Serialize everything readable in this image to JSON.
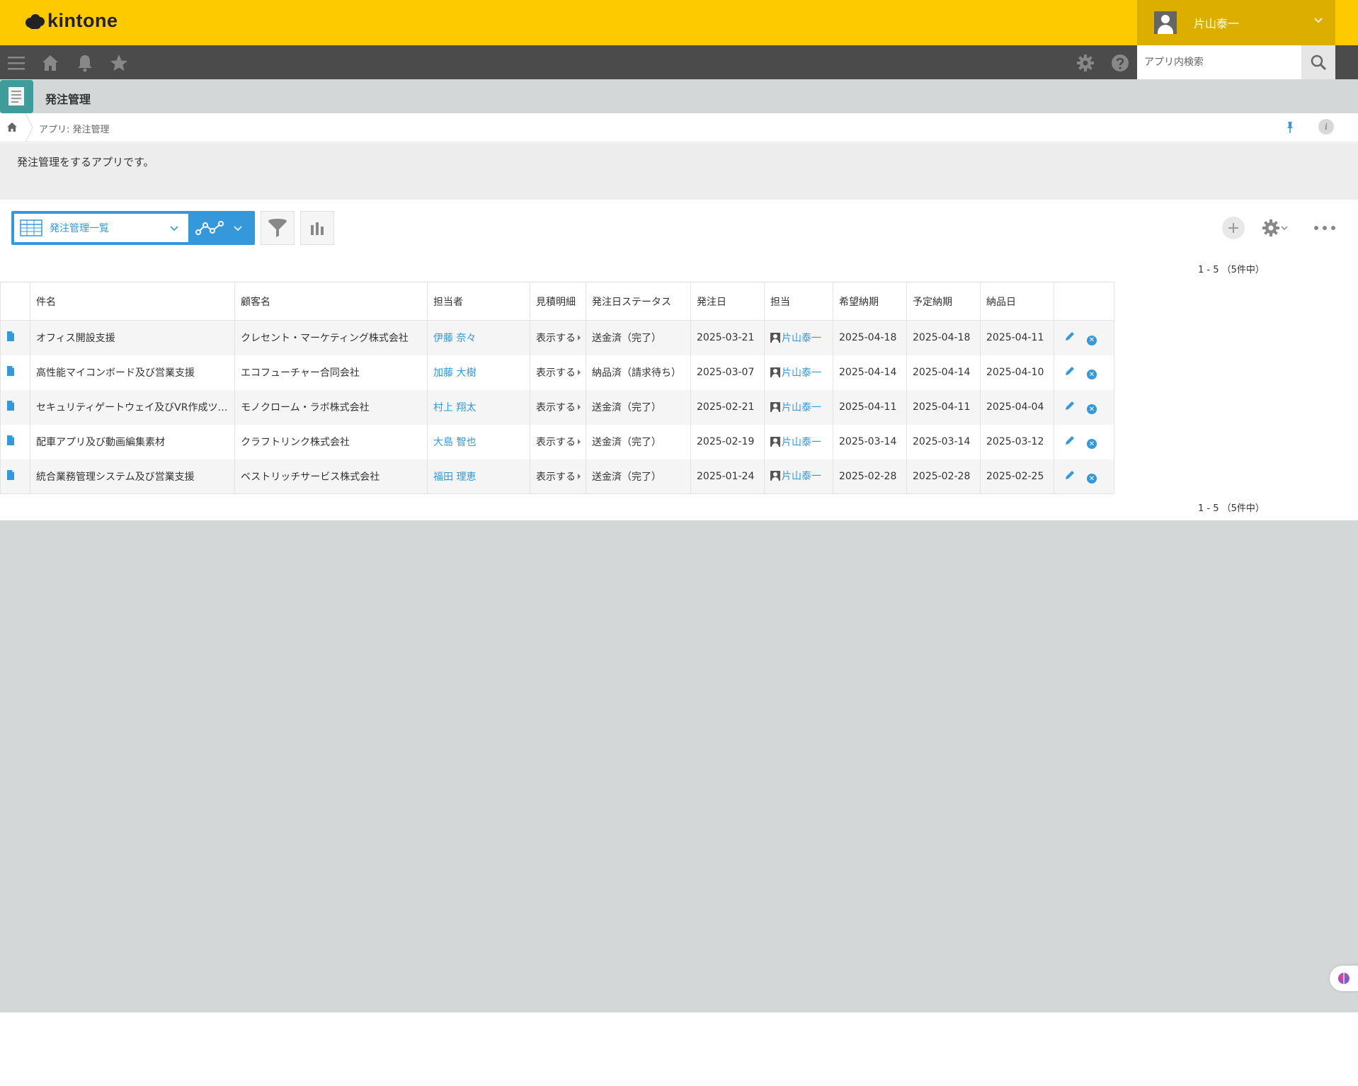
{
  "header": {
    "logo_text": "kintone",
    "user_name": "片山泰一"
  },
  "navbar": {
    "search_placeholder": "アプリ内検索"
  },
  "app": {
    "title": "発注管理",
    "breadcrumb": "アプリ: 発注管理",
    "description": "発注管理をするアプリです。"
  },
  "toolbar": {
    "view_name": "発注管理一覧"
  },
  "pager": {
    "top": "1 - 5 （5件中）",
    "bottom": "1 - 5 （5件中）"
  },
  "table": {
    "columns": [
      "件名",
      "顧客名",
      "担当者",
      "見積明細",
      "発注日ステータス",
      "発注日",
      "担当",
      "希望納期",
      "予定納期",
      "納品日"
    ],
    "rows": [
      {
        "subject": "オフィス開設支援",
        "customer": "クレセント・マーケティング株式会社",
        "rep": "伊藤 奈々",
        "quote": "表示する",
        "status": "送金済（完了）",
        "order_date": "2025-03-21",
        "owner": "片山泰一",
        "desired": "2025-04-18",
        "planned": "2025-04-18",
        "delivered": "2025-04-11"
      },
      {
        "subject": "高性能マイコンボード及び営業支援",
        "customer": "エコフューチャー合同会社",
        "rep": "加藤 大樹",
        "quote": "表示する",
        "status": "納品済（請求待ち）",
        "order_date": "2025-03-07",
        "owner": "片山泰一",
        "desired": "2025-04-14",
        "planned": "2025-04-14",
        "delivered": "2025-04-10"
      },
      {
        "subject": "セキュリティゲートウェイ及びVR作成ツ…",
        "customer": "モノクローム・ラボ株式会社",
        "rep": "村上 翔太",
        "quote": "表示する",
        "status": "送金済（完了）",
        "order_date": "2025-02-21",
        "owner": "片山泰一",
        "desired": "2025-04-11",
        "planned": "2025-04-11",
        "delivered": "2025-04-04"
      },
      {
        "subject": "配車アプリ及び動画編集素材",
        "customer": "クラフトリンク株式会社",
        "rep": "大島 智也",
        "quote": "表示する",
        "status": "送金済（完了）",
        "order_date": "2025-02-19",
        "owner": "片山泰一",
        "desired": "2025-03-14",
        "planned": "2025-03-14",
        "delivered": "2025-03-12"
      },
      {
        "subject": "統合業務管理システム及び営業支援",
        "customer": "ベストリッチサービス株式会社",
        "rep": "福田 理恵",
        "quote": "表示する",
        "status": "送金済（完了）",
        "order_date": "2025-01-24",
        "owner": "片山泰一",
        "desired": "2025-02-28",
        "planned": "2025-02-28",
        "delivered": "2025-02-25"
      }
    ]
  },
  "colors": {
    "header_bg": "#fdca00",
    "navbar_bg": "#4b4b4b",
    "accent": "#3498db"
  }
}
